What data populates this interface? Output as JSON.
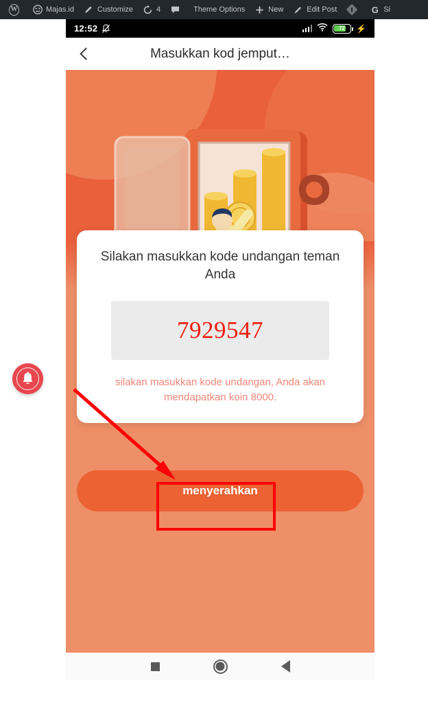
{
  "browser_toolbar": {
    "items": [
      {
        "icon": "wordpress-logo-icon",
        "label": ""
      },
      {
        "icon": "dashboard-icon",
        "label": "Majas.id"
      },
      {
        "icon": "brush-icon",
        "label": "Customize"
      },
      {
        "icon": "refresh-icon",
        "label": "4"
      },
      {
        "icon": "comment-icon",
        "label": ""
      },
      {
        "icon": "",
        "label": "Theme Options"
      },
      {
        "icon": "plus-icon",
        "label": "New"
      },
      {
        "icon": "pencil-icon",
        "label": "Edit Post"
      },
      {
        "icon": "diamond-icon",
        "label": ""
      },
      {
        "icon": "google-g-icon",
        "label": "Si"
      }
    ]
  },
  "status_bar": {
    "time": "12:52",
    "mute_icon": "bell-muted-icon",
    "signal_icon": "signal-bars-icon",
    "wifi_icon": "wifi-icon",
    "battery_percent": "72",
    "battery_icon": "battery-icon",
    "charging_icon": "charging-bolt-icon"
  },
  "app_bar": {
    "back_icon": "back-chevron-icon",
    "title": "Masukkan kod jemput…"
  },
  "hero": {
    "illustration": "safe-with-coins-illustration",
    "background_color": "#e9603b",
    "lower_background_color": "#ee8f68"
  },
  "card": {
    "title": "Silakan masukkan kode undangan teman Anda",
    "code_input": {
      "value": "7929547",
      "placeholder": "7929547",
      "text_color": "#f01d0e",
      "background_color": "#ebebeb"
    },
    "hint": "silakan masukkan kode undangan, Anda akan mendapatkan koin 8000.",
    "hint_color": "#ef8578"
  },
  "submit_button": {
    "label": "menyerahkan",
    "background_color": "#ec6233",
    "text_color": "#ffffff"
  },
  "nav_bar": {
    "recents_icon": "recents-square-icon",
    "home_icon": "home-circle-icon",
    "back_icon": "back-triangle-icon"
  },
  "floating_badge": {
    "icon": "notification-bell-icon",
    "color": "#e8474f"
  },
  "annotations": {
    "highlight_color": "#fb0007",
    "arrow": "red-arrow-pointing-to-submit-button",
    "rectangle": "red-rectangle-around-submit-button"
  }
}
